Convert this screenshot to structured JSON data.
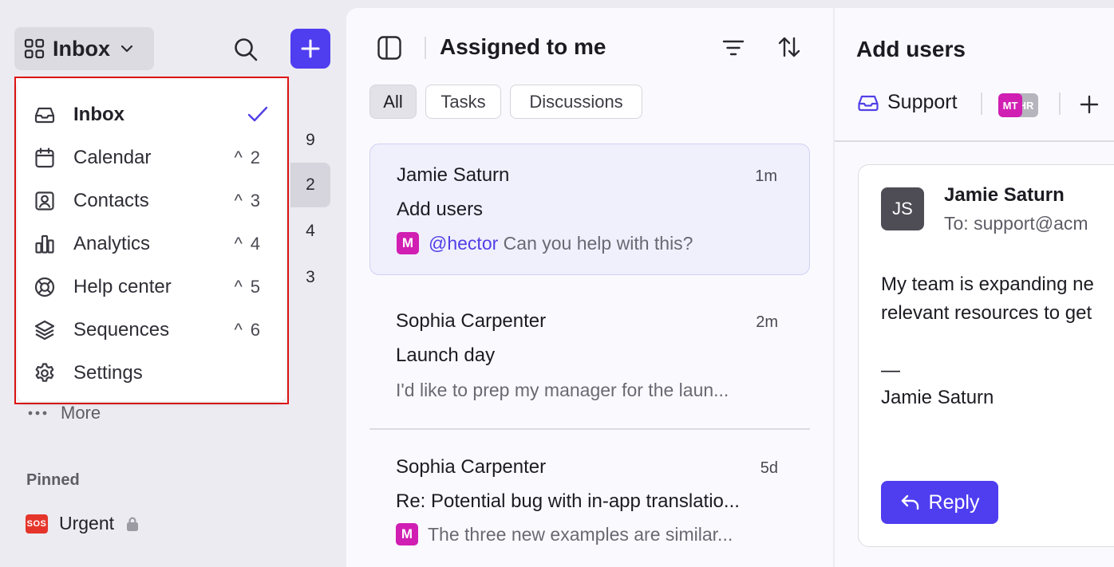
{
  "sidebar": {
    "workspace_label": "Inbox",
    "background_counts": [
      "9",
      "2",
      "4",
      "3"
    ],
    "more_label": "More",
    "pinned_heading": "Pinned",
    "pinned": [
      {
        "badge": "SOS",
        "label": "Urgent",
        "locked": true
      }
    ]
  },
  "dropdown": {
    "items": [
      {
        "icon": "inbox-tray-icon",
        "label": "Inbox",
        "selected": true,
        "shortcut": ""
      },
      {
        "icon": "calendar-icon",
        "label": "Calendar",
        "selected": false,
        "shortcut": "^2"
      },
      {
        "icon": "contact-card-icon",
        "label": "Contacts",
        "selected": false,
        "shortcut": "^3"
      },
      {
        "icon": "bar-chart-icon",
        "label": "Analytics",
        "selected": false,
        "shortcut": "^4"
      },
      {
        "icon": "lifebuoy-icon",
        "label": "Help center",
        "selected": false,
        "shortcut": "^5"
      },
      {
        "icon": "layers-icon",
        "label": "Sequences",
        "selected": false,
        "shortcut": "^6"
      },
      {
        "icon": "gear-icon",
        "label": "Settings",
        "selected": false,
        "shortcut": ""
      }
    ]
  },
  "middle": {
    "title": "Assigned to me",
    "filters": [
      {
        "label": "All",
        "active": true
      },
      {
        "label": "Tasks",
        "active": false
      },
      {
        "label": "Discussions",
        "active": false
      }
    ],
    "conversations": [
      {
        "name": "Jamie Saturn",
        "time": "1m",
        "subject": "Add users",
        "badge": "M",
        "mention": "@hector",
        "preview": "Can you help with this?",
        "selected": true
      },
      {
        "name": "Sophia Carpenter",
        "time": "2m",
        "subject": "Launch day",
        "badge": "",
        "mention": "",
        "preview": "I'd like to prep my manager for the laun...",
        "selected": false
      },
      {
        "name": "Sophia Carpenter",
        "time": "5d",
        "subject": "Re: Potential bug with in-app translatio...",
        "badge": "M",
        "mention": "",
        "preview": "The three new examples are similar...",
        "selected": false
      }
    ]
  },
  "right": {
    "title": "Add users",
    "inbox_label": "Support",
    "members": [
      "MT",
      "HR"
    ],
    "message": {
      "avatar": "JS",
      "sender": "Jamie Saturn",
      "to": "To: support@acm",
      "body_lines": [
        "My team is expanding ne",
        "relevant resources to get"
      ],
      "signature_dash": "—",
      "signature": "Jamie Saturn"
    },
    "reply_label": "Reply"
  },
  "colors": {
    "accent": "#4f3df0",
    "badge_magenta": "#d01fb2",
    "highlight_border": "#e01313"
  }
}
